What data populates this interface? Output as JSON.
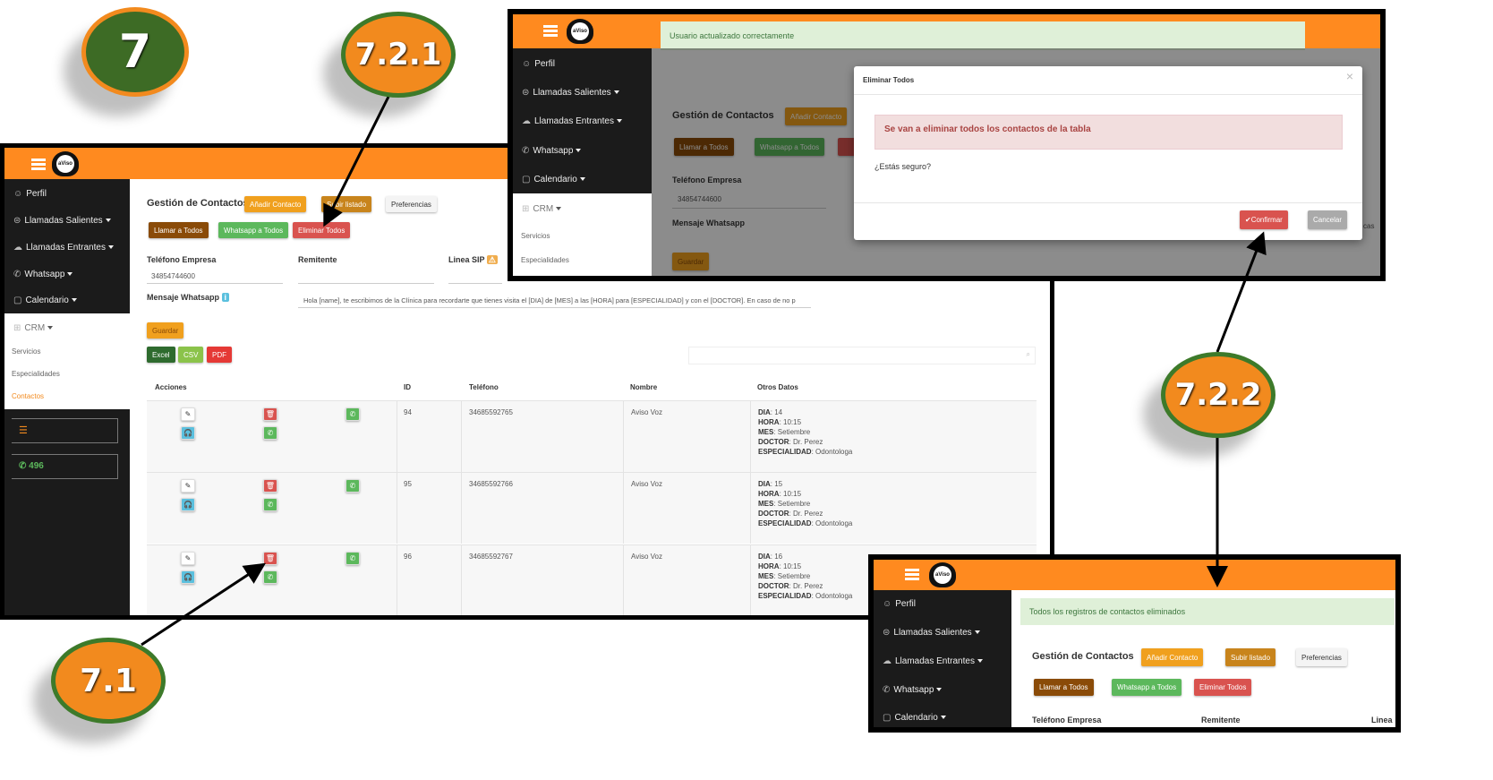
{
  "badges": {
    "main": "7",
    "delete_all": "7.2.1",
    "confirm": "7.2.2",
    "delete_row": "7.1"
  },
  "app": {
    "logo_text": "aViso Voz",
    "sidebar": [
      "Perfil",
      "Llamadas Salientes",
      "Llamadas Entrantes",
      "Whatsapp",
      "Calendario",
      "CRM"
    ],
    "crm_items": [
      "Servicios",
      "Especialidades",
      "Contactos"
    ],
    "whatsapp_count": "496"
  },
  "page": {
    "title": "Gestión de Contactos",
    "buttons": {
      "add": "Añadir Contacto",
      "upload": "Subir listado",
      "prefs": "Preferencias",
      "call_all": "Llamar a Todos",
      "whatsapp_all": "Whatsapp a Todos",
      "delete_all": "Eliminar Todos",
      "save": "Guardar",
      "excel": "Excel",
      "csv": "CSV",
      "pdf": "PDF"
    },
    "fields": {
      "phone_label": "Teléfono Empresa",
      "phone_value": "34854744600",
      "sender_label": "Remitente",
      "sip_label": "Linea SIP",
      "sip_short": "Linea",
      "msg_label": "Mensaje Whatsapp",
      "msg_value": "Hola [name], te escribimos de la Clínica para recordarte que tienes visita el [DIA] de [MES] a las [HORA] para [ESPECIALIDAD] y con el [DOCTOR]. En caso de no p"
    },
    "table": {
      "headers": [
        "Acciones",
        "ID",
        "Teléfono",
        "Nombre",
        "Otros Datos"
      ],
      "rows": [
        {
          "id": "94",
          "phone": "34685592765",
          "name": "Aviso Voz",
          "dia": "14",
          "hora": "10:15",
          "mes": "Setiembre",
          "doctor": "Dr. Perez",
          "esp": "Odontologa"
        },
        {
          "id": "95",
          "phone": "34685592766",
          "name": "Aviso Voz",
          "dia": "15",
          "hora": "10:15",
          "mes": "Setiembre",
          "doctor": "Dr. Perez",
          "esp": "Odontologa"
        },
        {
          "id": "96",
          "phone": "34685592767",
          "name": "Aviso Voz",
          "dia": "16",
          "hora": "10:15",
          "mes": "Setiembre",
          "doctor": "Dr. Perez",
          "esp": "Odontologa"
        }
      ],
      "keys": {
        "dia": "DIA",
        "hora": "HORA",
        "mes": "MES",
        "doctor": "DOCTOR",
        "esp": "ESPECIALIDAD"
      }
    }
  },
  "alerts": {
    "user_updated": "Usuario actualizado correctamente",
    "all_deleted": "Todos los registros de contactos eliminados"
  },
  "modal": {
    "title": "Eliminar Todos",
    "warning": "Se van a eliminar todos los contactos de la tabla",
    "question": "¿Estás seguro?",
    "confirm": "Confirmar",
    "cancel": "Cancelar",
    "close": "×",
    "behind_text": "cas"
  },
  "colors": {
    "orange": "#ff8a1f",
    "danger": "#d9534f",
    "success": "#5cb85c",
    "brown": "#8a4b08",
    "warning": "#f0a01e",
    "info": "#5bc0de"
  }
}
